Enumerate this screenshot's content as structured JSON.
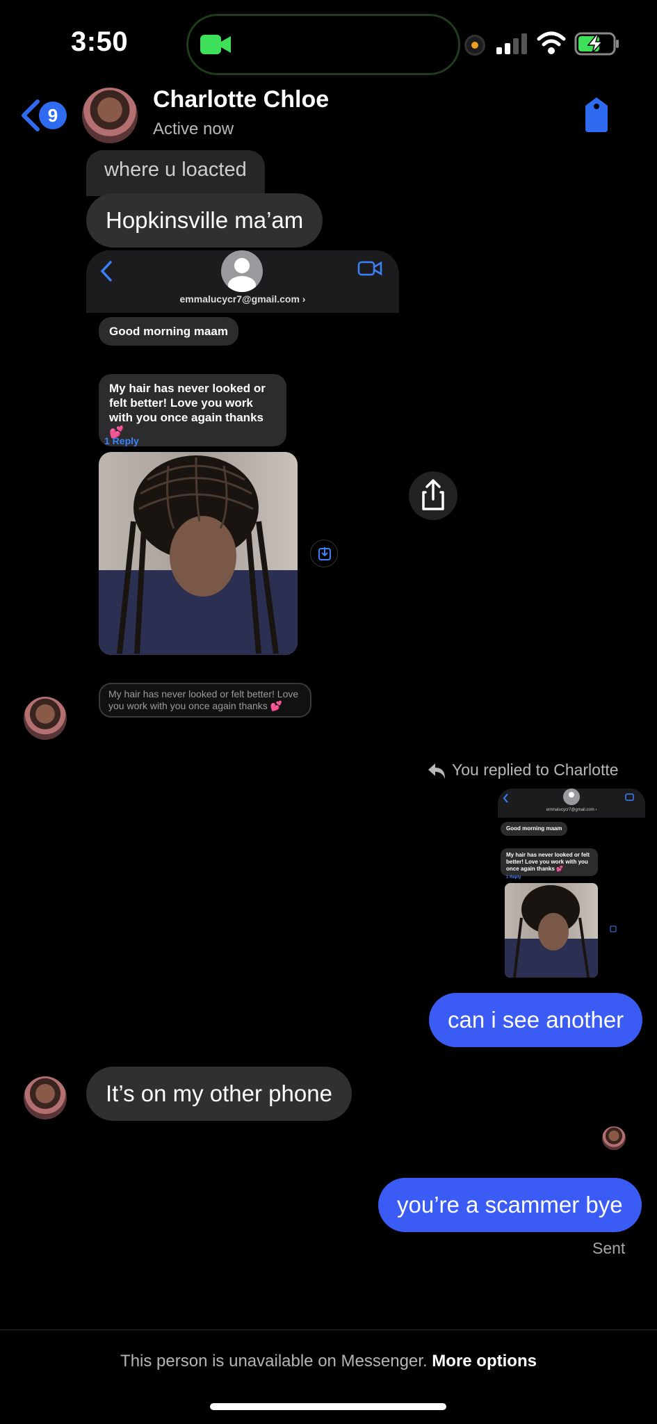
{
  "status_bar": {
    "time": "3:50"
  },
  "header": {
    "back_badge": "9",
    "name": "Charlotte Chloe",
    "status": "Active now"
  },
  "messages": {
    "in1": "where u loacted",
    "in2": "Hopkinsville ma’am",
    "replied_label": "You replied to Charlotte",
    "out1": "can i see another",
    "in3": "It’s on my other phone",
    "out2": "you’re a scammer bye",
    "sent_label": "Sent"
  },
  "screenshot": {
    "email": "emmalucycr7@gmail.com ›",
    "m1": "Good morning maam",
    "m2": "My hair has never looked or felt better! Love you work with you once again thanks 💕",
    "reply_label": "1 Reply",
    "m3": "My hair has never looked or felt better! Love you work with you once again thanks 💕"
  },
  "mini": {
    "email": "emmalucycr7@gmail.com ›",
    "m1": "Good morning maam",
    "m2": "My hair has never looked or felt better! Love you work with you once again thanks 💕",
    "reply_label": "1 Reply"
  },
  "footer": {
    "text": "This person is unavailable on Messenger.",
    "link": "More options"
  },
  "colors": {
    "accent": "#3b5bf5",
    "link": "#2e6bf0"
  }
}
